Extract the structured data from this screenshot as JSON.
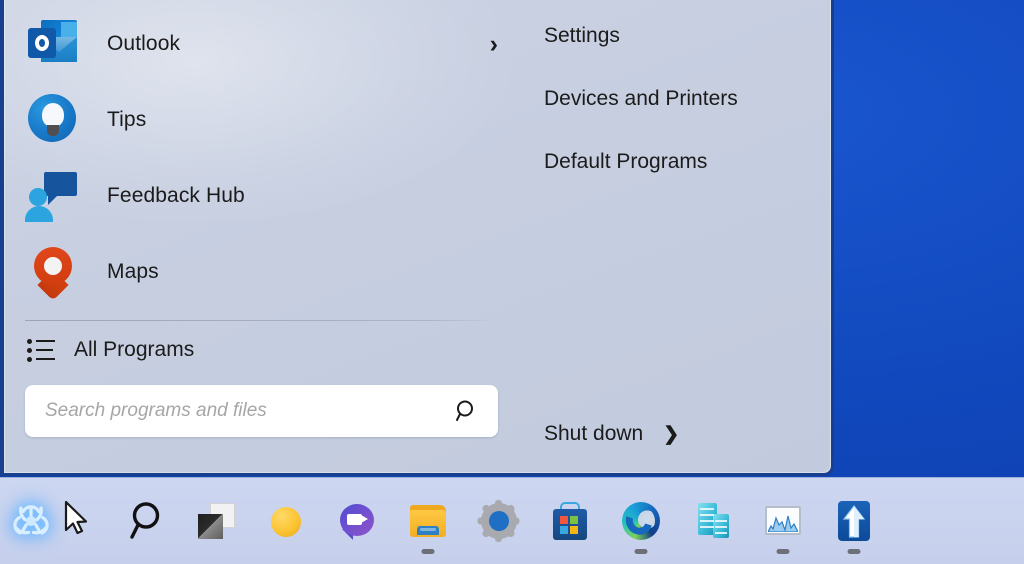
{
  "desktop": {
    "background_color": "#1148bd"
  },
  "start_menu": {
    "left_pane": {
      "apps": [
        {
          "label": "Outlook",
          "icon": "outlook-icon",
          "has_submenu": true,
          "chevron": "›"
        },
        {
          "label": "Tips",
          "icon": "tips-icon",
          "has_submenu": false,
          "chevron": ""
        },
        {
          "label": "Feedback Hub",
          "icon": "feedback-hub-icon",
          "has_submenu": false,
          "chevron": ""
        },
        {
          "label": "Maps",
          "icon": "maps-icon",
          "has_submenu": false,
          "chevron": ""
        }
      ],
      "all_programs": {
        "label": "All Programs",
        "icon": "list-icon"
      },
      "search": {
        "placeholder": "Search programs and files",
        "value": "",
        "icon": "search-icon"
      }
    },
    "right_pane": {
      "items": [
        {
          "label": "Settings"
        },
        {
          "label": "Devices and Printers"
        },
        {
          "label": "Default Programs"
        }
      ],
      "shutdown": {
        "label": "Shut down",
        "chevron": "❯"
      }
    }
  },
  "taskbar": {
    "items": [
      {
        "name": "start-button",
        "icon": "biohazard-icon",
        "running": false
      },
      {
        "name": "mouse-cursor",
        "icon": "cursor-arrow-icon",
        "running": false
      },
      {
        "name": "search-button",
        "icon": "search-icon",
        "running": false
      },
      {
        "name": "task-view-button",
        "icon": "task-view-icon",
        "running": false
      },
      {
        "name": "widgets-button",
        "icon": "widgets-icon",
        "running": false
      },
      {
        "name": "chat-button",
        "icon": "chat-icon",
        "running": false
      },
      {
        "name": "file-explorer-button",
        "icon": "folder-icon",
        "running": true
      },
      {
        "name": "settings-button",
        "icon": "gear-icon",
        "running": false
      },
      {
        "name": "microsoft-store-button",
        "icon": "store-bag-icon",
        "running": false
      },
      {
        "name": "edge-button",
        "icon": "edge-icon",
        "running": true
      },
      {
        "name": "server-manager-button",
        "icon": "server-stack-icon",
        "running": false
      },
      {
        "name": "task-manager-button",
        "icon": "performance-chart-icon",
        "running": true
      },
      {
        "name": "update-button",
        "icon": "arrow-up-icon",
        "running": true
      }
    ]
  }
}
